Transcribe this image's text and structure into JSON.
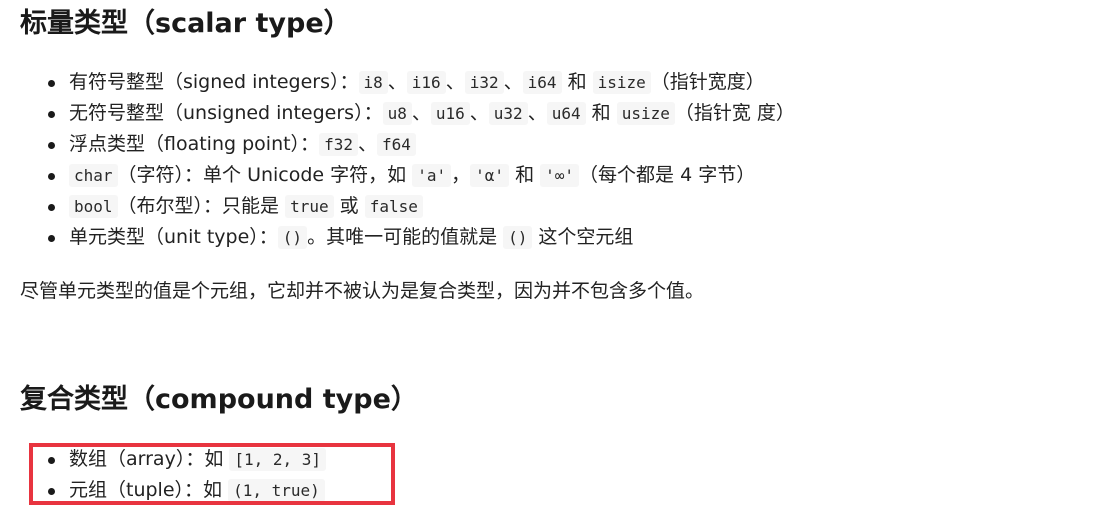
{
  "scalar": {
    "heading": "标量类型（scalar type）",
    "items": [
      {
        "label": "有符号整型（signed integers）：",
        "c1": "i8",
        "s1": "、",
        "c2": "i16",
        "s2": "、",
        "c3": "i32",
        "s3": "、",
        "c4": "i64",
        "s4": " 和 ",
        "c5": "isize",
        "tail": "（指针宽度）"
      },
      {
        "label": "无符号整型（unsigned integers）：",
        "c1": "u8",
        "s1": "、",
        "c2": "u16",
        "s2": "、",
        "c3": "u32",
        "s3": "、",
        "c4": "u64",
        "s4": " 和 ",
        "c5": "usize",
        "tail": "（指针宽 度）"
      },
      {
        "label": "浮点类型（floating point）：",
        "c1": "f32",
        "s1": "、",
        "c2": "f64"
      },
      {
        "c0": "char",
        "label": "（字符）：单个 Unicode 字符，如 ",
        "c1": "'a'",
        "s1": "，",
        "c2": "'α'",
        "s2": " 和 ",
        "c3": "'∞'",
        "tail": "（每个都是 4 字节）"
      },
      {
        "c0": "bool",
        "label": "（布尔型）：只能是 ",
        "c1": "true",
        "s1": " 或 ",
        "c2": "false"
      },
      {
        "label": "单元类型（unit type）：",
        "c1": "()",
        "s1": "。其唯一可能的值就是 ",
        "c2": "()",
        "tail": " 这个空元组"
      }
    ]
  },
  "note": "尽管单元类型的值是个元组，它却并不被认为是复合类型，因为并不包含多个值。",
  "compound": {
    "heading": "复合类型（compound type）",
    "items": [
      {
        "label": "数组（array）：如 ",
        "c1": "[1, 2, 3]"
      },
      {
        "label": "元组（tuple）：如 ",
        "c1": "(1, true)"
      }
    ]
  },
  "colors": {
    "highlight_border": "#e8343f",
    "code_background": "#f6f6f6",
    "text": "#222222"
  }
}
